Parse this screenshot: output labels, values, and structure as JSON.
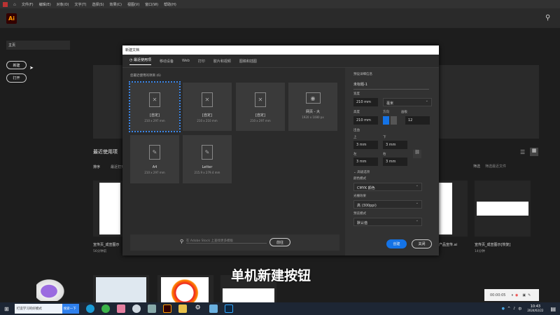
{
  "menubar": {
    "items": [
      "文件(F)",
      "编辑(E)",
      "对象(O)",
      "文字(T)",
      "选择(S)",
      "效果(C)",
      "视图(V)",
      "窗口(W)",
      "帮助(H)"
    ]
  },
  "app": {
    "logo": "Ai",
    "home": "主页",
    "new_button": "新建",
    "open_button": "打开"
  },
  "recent": {
    "title": "最近使用项",
    "sort": "排序",
    "sort_value": "最近打开",
    "filter_label": "筛选",
    "filter_placeholder": "筛选最近文件",
    "files": [
      {
        "name": "宣传页_成宣图示",
        "meta": "56分钟前"
      },
      {
        "name": "宣传页_成宣图示[恢复]",
        "meta": "14分钟"
      },
      {
        "name": "产品宣传.ai",
        "meta": ""
      }
    ]
  },
  "dialog": {
    "title": "新建文档",
    "tabs": [
      "最近使用项",
      "移动设备",
      "Web",
      "打印",
      "胶片和视频",
      "图稿和插图"
    ],
    "tab_first": "移动设备",
    "section": "您最近使用的项目 (6)",
    "presets": [
      {
        "name": "[自定]",
        "size": "210 x 297 mm"
      },
      {
        "name": "[自定]",
        "size": "210 x 210 mm"
      },
      {
        "name": "[自定]",
        "size": "210 x 297 mm"
      },
      {
        "name": "网页 - 大",
        "size": "1920 x 1080 px"
      },
      {
        "name": "A4",
        "size": "210 x 297 mm"
      },
      {
        "name": "Letter",
        "size": "215.9 x 279.4 mm"
      }
    ],
    "search_placeholder": "在 Adobe Stock 上查找更多模板",
    "go_button": "前往",
    "details": {
      "header": "预设详细信息",
      "doc_name": "未标题-1",
      "width_label": "宽度",
      "width": "210 mm",
      "unit": "毫米",
      "height_label": "高度",
      "height": "210 mm",
      "orientation_label": "方向",
      "artboards_label": "画板",
      "artboards": "12",
      "bleed_label": "出血",
      "top_label": "上",
      "top": "3 mm",
      "bottom_label": "下",
      "bottom": "3 mm",
      "left_label": "左",
      "left": "3 mm",
      "right_label": "右",
      "right": "3 mm",
      "advanced": "高级选项",
      "color_mode_label": "颜色模式",
      "color_mode": "CMYK 颜色",
      "raster_label": "光栅效果",
      "raster": "高 (300ppi)",
      "preview_label": "预览模式",
      "preview": "默认值"
    },
    "create_button": "创建",
    "close_button": "关闭"
  },
  "subtitle": "单机新建按钮",
  "recorder": {
    "time": "00:00:05"
  },
  "taskbar": {
    "search": "打造学习的好模式",
    "search_button": "搜索一下",
    "time": "10:43",
    "date": "2024/02/22",
    "ime": "中"
  },
  "colors": {
    "accent": "#1473e6",
    "bg": "#1d1d1d"
  }
}
